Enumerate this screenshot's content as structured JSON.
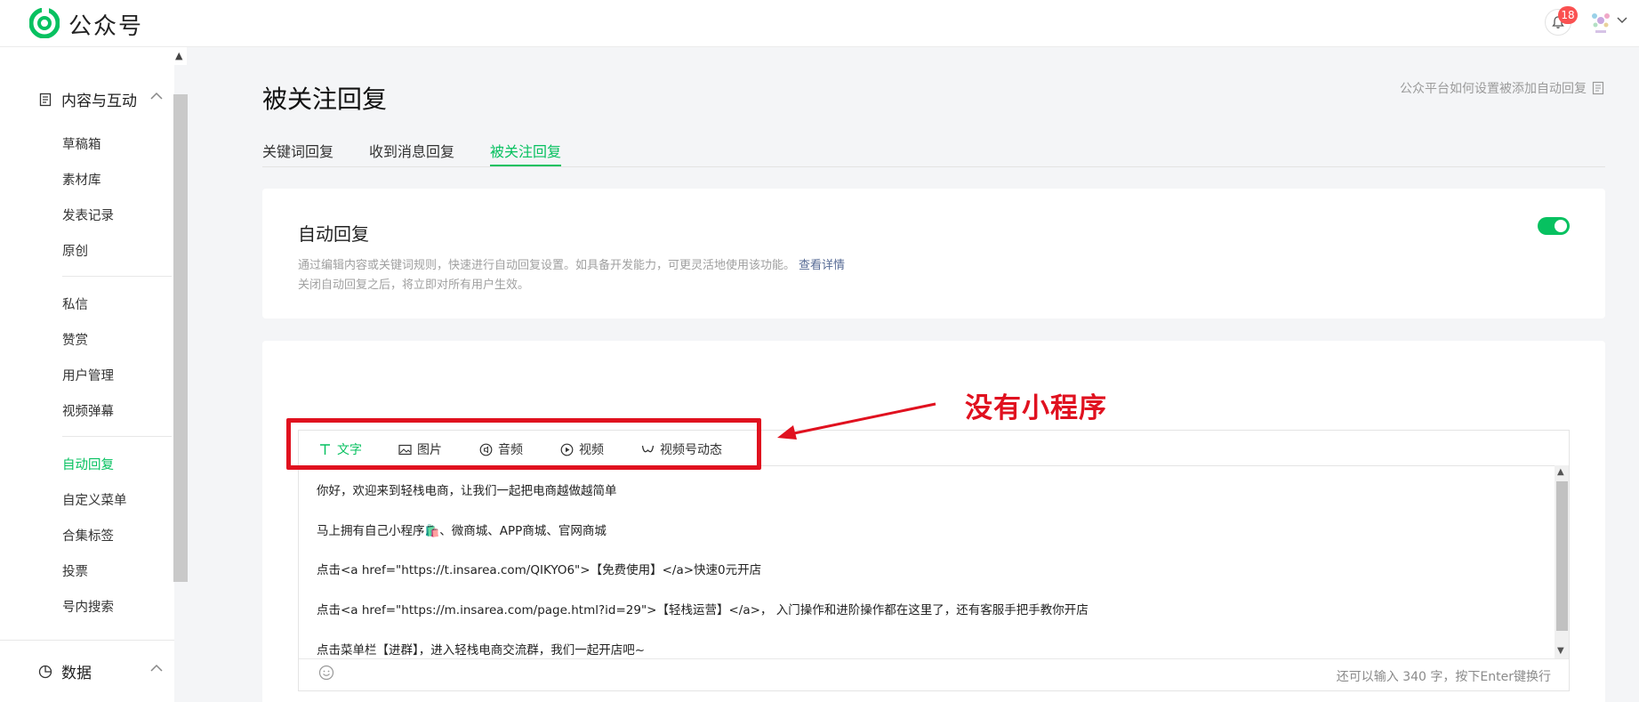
{
  "app": {
    "brand": "公众号",
    "notification_count": "18"
  },
  "sidebar": {
    "section_content": "内容与互动",
    "group1": [
      "草稿箱",
      "素材库",
      "发表记录",
      "原创"
    ],
    "group2": [
      "私信",
      "赞赏",
      "用户管理",
      "视频弹幕"
    ],
    "group3": [
      "自动回复",
      "自定义菜单",
      "合集标签",
      "投票",
      "号内搜索"
    ],
    "section_data": "数据",
    "active_item": "自动回复"
  },
  "page": {
    "title": "被关注回复",
    "help_link": "公众平台如何设置被添加自动回复",
    "tabs": [
      "关键词回复",
      "收到消息回复",
      "被关注回复"
    ],
    "active_tab": "被关注回复"
  },
  "auto_reply": {
    "title": "自动回复",
    "desc1": "通过编辑内容或关键词规则，快速进行自动回复设置。如具备开发能力，可更灵活地使用该功能。",
    "desc1_link": "查看详情",
    "desc2": "关闭自动回复之后，将立即对所有用户生效。",
    "enabled": true
  },
  "editor": {
    "tools": [
      "文字",
      "图片",
      "音频",
      "视频",
      "视频号动态"
    ],
    "active_tool": "文字",
    "lines": [
      "你好，欢迎来到轻栈电商，让我们一起把电商越做越简单",
      "马上拥有自己小程序🛍️、微商城、APP商城、官网商城",
      "点击<a href=\"https://t.insarea.com/QIKYO6\">【免费使用】</a>快速0元开店",
      "点击<a href=\"https://m.insarea.com/page.html?id=29\">【轻栈运营】</a>， 入门操作和进阶操作都在这里了，还有客服手把手教你开店",
      "点击菜单栏【进群】，进入轻栈电商交流群，我们一起开店吧~"
    ],
    "counter": "还可以输入 340 字，按下Enter键换行"
  },
  "annotation": {
    "text": "没有小程序",
    "color": "#e0111f"
  },
  "colors": {
    "accent": "#07c160",
    "link": "#576b95",
    "badge": "#fa5151"
  }
}
